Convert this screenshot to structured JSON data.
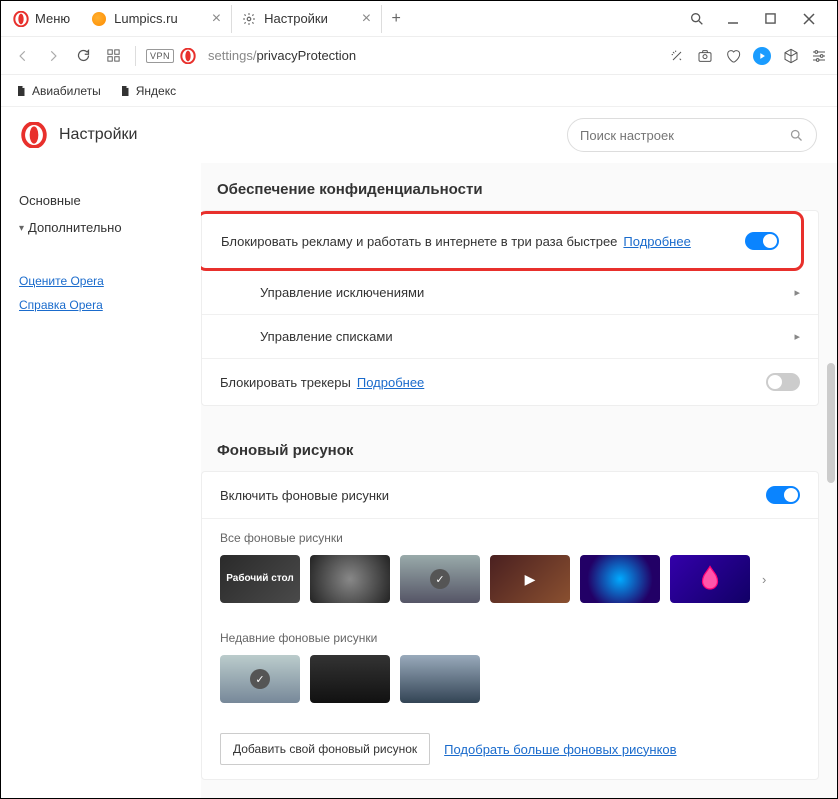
{
  "titlebar": {
    "menu_label": "Меню",
    "tabs": [
      {
        "label": "Lumpics.ru"
      },
      {
        "label": "Настройки"
      }
    ]
  },
  "toolbar": {
    "vpn": "VPN",
    "url_prefix": "settings/",
    "url_path": "privacyProtection"
  },
  "bookmarks": [
    "Авиабилеты",
    "Яндекс"
  ],
  "header": {
    "title": "Настройки",
    "search_placeholder": "Поиск настроек"
  },
  "sidebar": {
    "items": [
      "Основные",
      "Дополнительно"
    ],
    "links": [
      "Оцените Opera",
      "Справка Opera"
    ]
  },
  "privacy": {
    "section_title": "Обеспечение конфиденциальности",
    "adblock_label": "Блокировать рекламу и работать в интернете в три раза быстрее",
    "learn_more": "Подробнее",
    "manage_exceptions": "Управление исключениями",
    "manage_lists": "Управление списками",
    "block_trackers": "Блокировать трекеры",
    "trackers_more": "Подробнее"
  },
  "wallpaper": {
    "section_title": "Фоновый рисунок",
    "enable_label": "Включить фоновые рисунки",
    "all_label": "Все фоновые рисунки",
    "desktop_label": "Рабочий стол",
    "recent_label": "Недавние фоновые рисунки",
    "add_btn": "Добавить свой фоновый рисунок",
    "more_link": "Подобрать больше фоновых рисунков"
  }
}
